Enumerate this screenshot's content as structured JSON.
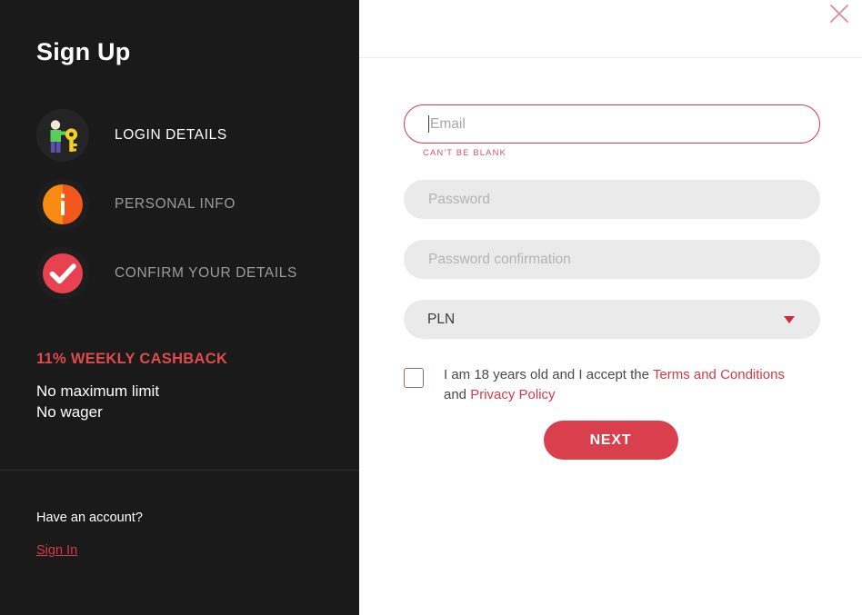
{
  "sidebar": {
    "title": "Sign Up",
    "steps": [
      {
        "label": "LOGIN DETAILS",
        "icon": "person-with-key-icon",
        "state": "active"
      },
      {
        "label": "PERSONAL INFO",
        "icon": "info-circle-icon",
        "state": "inactive"
      },
      {
        "label": "CONFIRM YOUR DETAILS",
        "icon": "check-circle-icon",
        "state": "inactive"
      }
    ],
    "promo": {
      "title": "11% WEEKLY CASHBACK",
      "line1": "No maximum limit",
      "line2": "No wager"
    },
    "account": {
      "question": "Have an account?",
      "signin_label": "Sign In"
    }
  },
  "panel": {
    "close_icon": "close-icon",
    "form": {
      "email": {
        "value": "",
        "placeholder": "Email",
        "error": "CAN'T BE BLANK"
      },
      "password": {
        "value": "",
        "placeholder": "Password"
      },
      "password_confirmation": {
        "value": "",
        "placeholder": "Password confirmation"
      },
      "currency": {
        "selected": "PLN",
        "arrow_icon": "chevron-down-icon"
      },
      "terms": {
        "checked": false,
        "text_before": "I am 18 years old and I accept the ",
        "link_terms": "Terms and Conditions",
        "text_middle": " and ",
        "link_privacy": "Privacy Policy"
      },
      "submit_label": "NEXT"
    }
  },
  "colors": {
    "sidebar_bg": "#1a1a1a",
    "accent_red": "#d93f4c",
    "promo_red": "#e04a4a",
    "link_red": "#d6394a",
    "input_grey": "#eaeaea"
  }
}
